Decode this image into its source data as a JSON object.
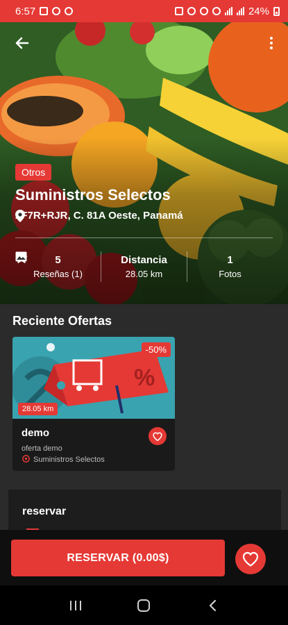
{
  "status_bar": {
    "time": "6:57",
    "battery": "24%",
    "background": "#e53935"
  },
  "header": {
    "back_icon": "arrow-left-icon",
    "menu_icon": "more-vertical-icon"
  },
  "store": {
    "category": "Otros",
    "name": "Suministros Selectos",
    "address": "2F7R+RJR, C. 81A Oeste, Panamá"
  },
  "stats": {
    "rating_value": "5",
    "reviews_label": "Reseñas (1)",
    "distance_label": "Distancia",
    "distance_value": "28.05 km",
    "photos_count": "1",
    "photos_label": "Fotos"
  },
  "offers": {
    "section_title": "Reciente Ofertas",
    "items": [
      {
        "discount": "-50%",
        "distance": "28.05 km",
        "title": "demo",
        "description": "oferta demo",
        "store": "Suministros Selectos"
      }
    ]
  },
  "reservation": {
    "title": "reservar"
  },
  "actions": {
    "reserve_label": "RESERVAR (0.00$)",
    "favorite_icon": "heart-icon"
  },
  "colors": {
    "accent": "#e53935",
    "background": "#2b2b2b",
    "card": "#1a1a1a"
  }
}
